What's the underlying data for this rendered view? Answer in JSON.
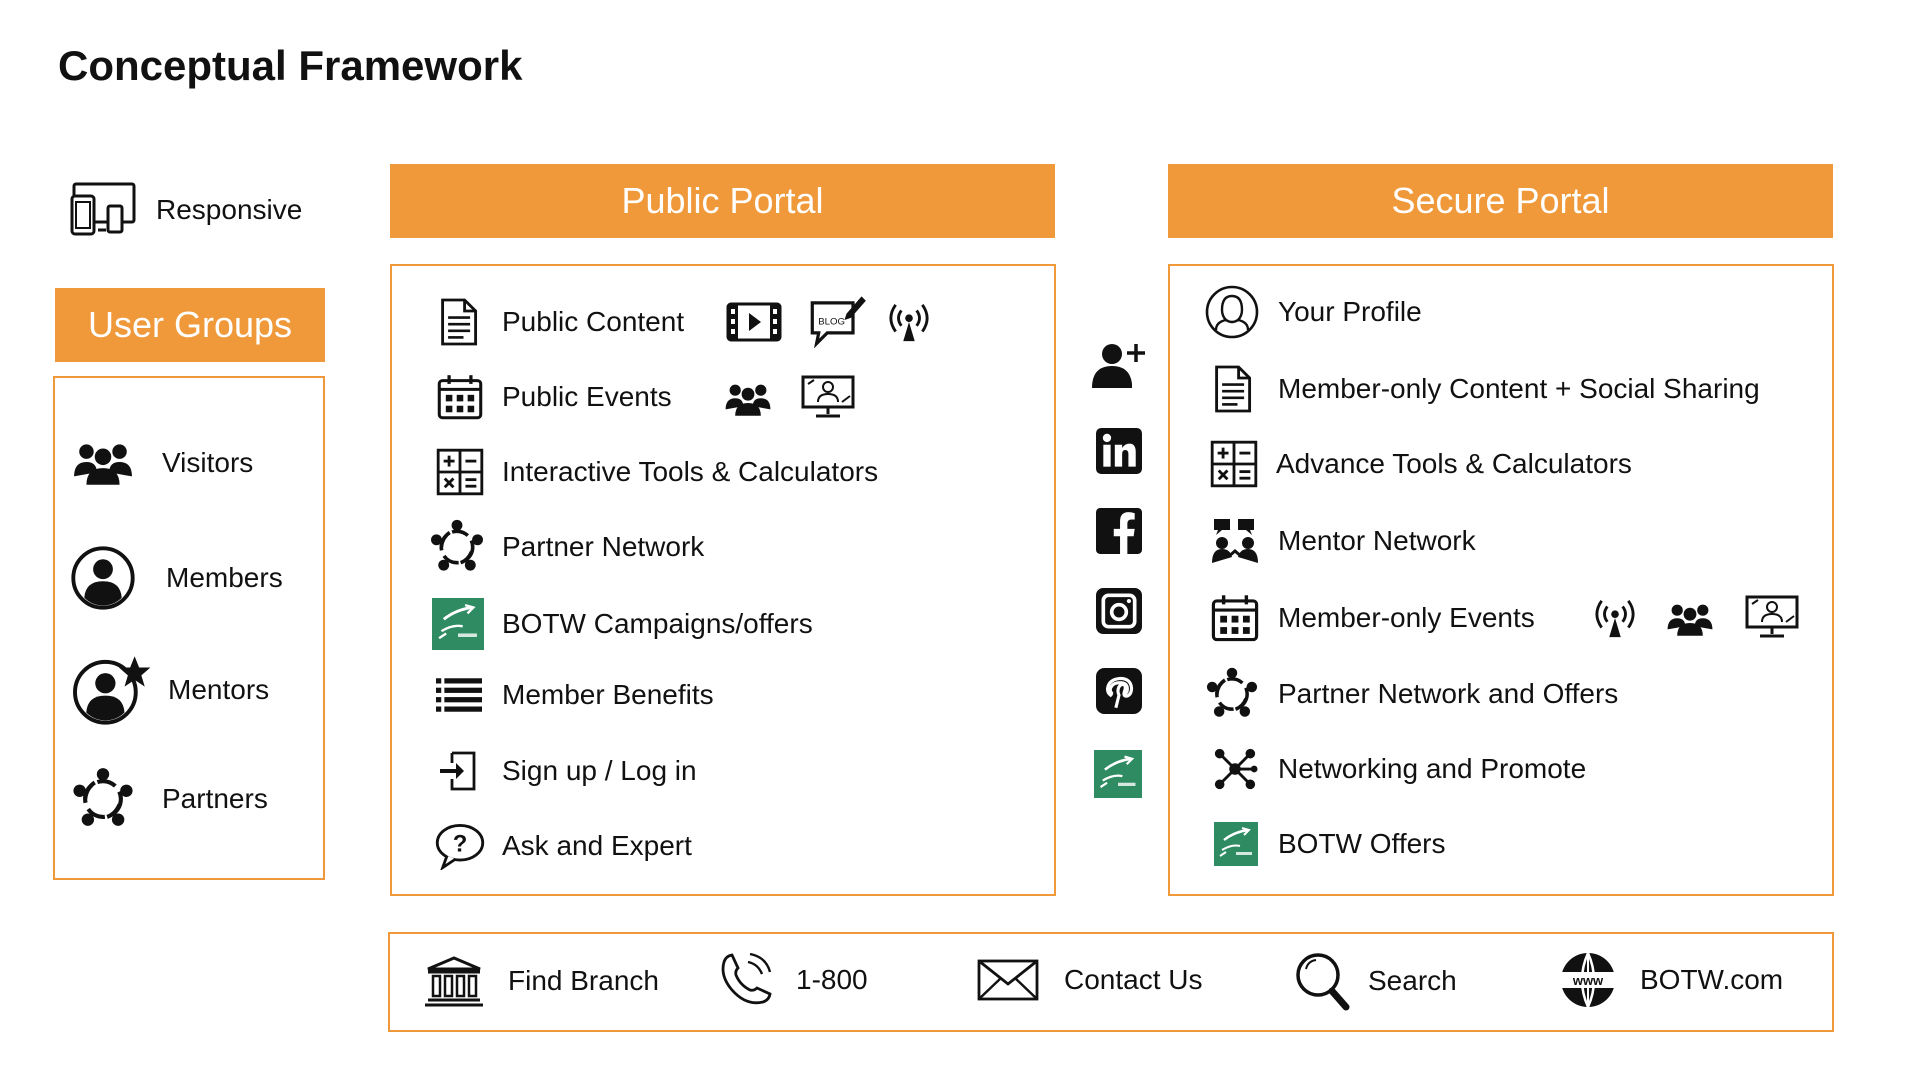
{
  "title": "Conceptual Framework",
  "responsive": {
    "label": "Responsive",
    "icon": "devices-icon"
  },
  "user_groups": {
    "header": "User Groups",
    "items": [
      {
        "label": "Visitors",
        "icon": "group-icon"
      },
      {
        "label": "Members",
        "icon": "user-circle-icon"
      },
      {
        "label": "Mentors",
        "icon": "user-star-icon"
      },
      {
        "label": "Partners",
        "icon": "partner-network-icon"
      }
    ]
  },
  "public_portal": {
    "header": "Public Portal",
    "items": [
      {
        "label": "Public Content",
        "icon": "document-icon",
        "extras": [
          "video-icon",
          "blog-icon",
          "broadcast-icon"
        ]
      },
      {
        "label": "Public Events",
        "icon": "calendar-icon",
        "extras": [
          "group-icon",
          "webinar-icon"
        ]
      },
      {
        "label": "Interactive Tools & Calculators",
        "icon": "calculator-icon"
      },
      {
        "label": "Partner Network",
        "icon": "partner-network-icon"
      },
      {
        "label": "BOTW Campaigns/offers",
        "icon": "bank-logo-icon"
      },
      {
        "label": "Member Benefits",
        "icon": "list-icon"
      },
      {
        "label": "Sign up / Log in",
        "icon": "sign-in-icon"
      },
      {
        "label": "Ask and Expert",
        "icon": "question-bubble-icon"
      }
    ]
  },
  "social_column": [
    "add-user-icon",
    "linkedin-icon",
    "facebook-icon",
    "instagram-icon",
    "pinterest-icon",
    "bank-logo-icon"
  ],
  "secure_portal": {
    "header": "Secure Portal",
    "items": [
      {
        "label": "Your Profile",
        "icon": "profile-icon"
      },
      {
        "label": "Member-only Content + Social Sharing",
        "icon": "document-icon"
      },
      {
        "label": "Advance Tools & Calculators",
        "icon": "calculator-icon"
      },
      {
        "label": "Mentor Network",
        "icon": "mentor-icon"
      },
      {
        "label": "Member-only Events",
        "icon": "calendar-icon",
        "extras": [
          "broadcast-icon",
          "group-icon",
          "webinar-icon"
        ]
      },
      {
        "label": "Partner Network and Offers",
        "icon": "partner-network-icon"
      },
      {
        "label": "Networking and Promote",
        "icon": "network-icon"
      },
      {
        "label": "BOTW Offers",
        "icon": "bank-logo-icon"
      }
    ]
  },
  "footer": {
    "items": [
      {
        "label": "Find Branch",
        "icon": "bank-building-icon"
      },
      {
        "label": "1-800",
        "icon": "phone-icon"
      },
      {
        "label": "Contact Us",
        "icon": "envelope-icon"
      },
      {
        "label": "Search",
        "icon": "search-icon"
      },
      {
        "label": "BOTW.com",
        "icon": "globe-icon"
      }
    ]
  },
  "colors": {
    "accent": "#F0993A",
    "bank_green": "#2E8B62",
    "text": "#111111"
  }
}
